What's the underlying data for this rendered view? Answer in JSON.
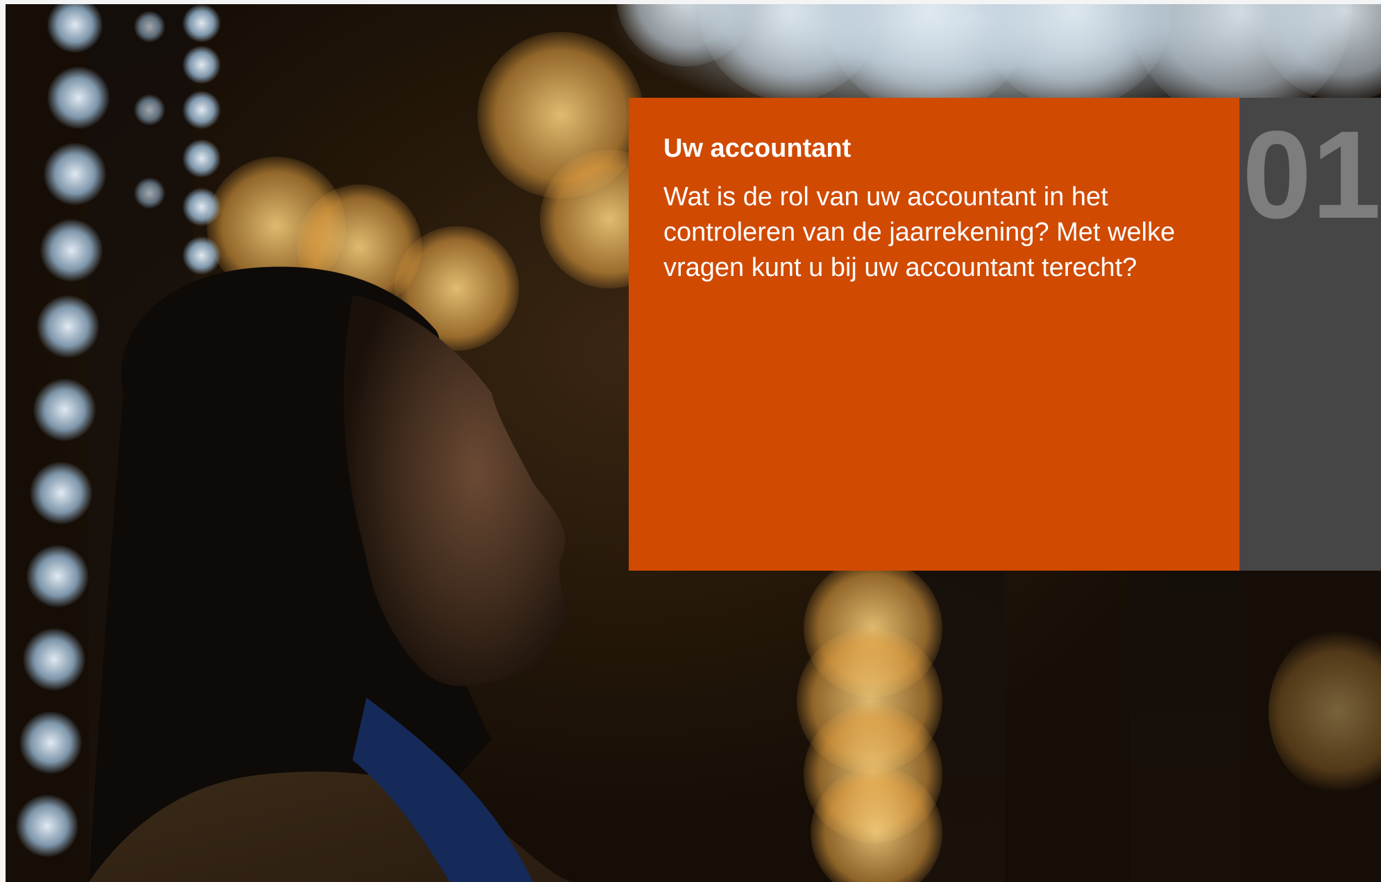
{
  "slide": {
    "title": "Uw accountant",
    "body": "Wat is de rol van uw accountant in het controleren van de jaarrekening? Met welke vragen kunt u bij uw accountant terecht?",
    "number": "01"
  },
  "colors": {
    "accent_orange": "#d04a02",
    "number_panel": "#464646",
    "number_text": "#7d7d7d",
    "text": "#ffffff"
  },
  "image": {
    "subject": "woman looking up at night bokeh lights"
  }
}
